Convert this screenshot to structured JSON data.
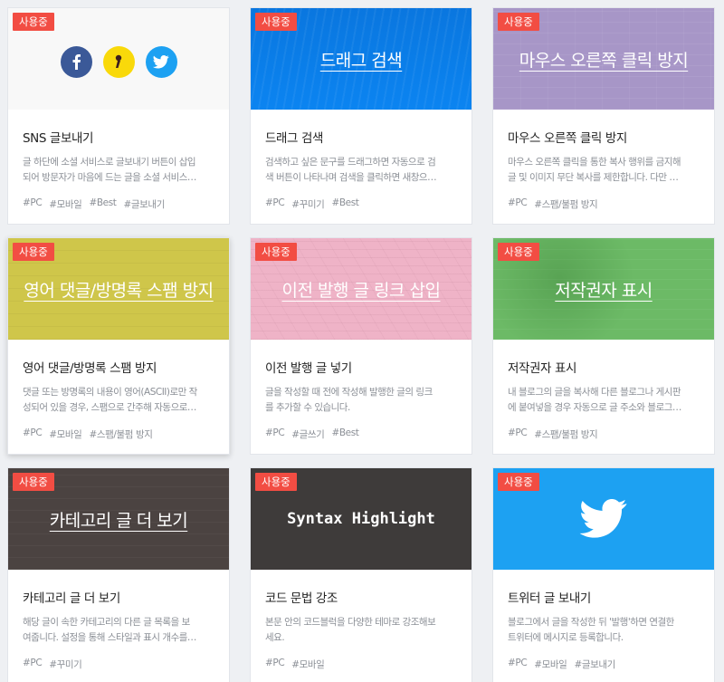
{
  "badge_label": "사용중",
  "cards": [
    {
      "thumb_title": "",
      "name": "SNS 글보내기",
      "desc": [
        "글 하단에 소셜 서비스로 글보내기 버튼이 삽입",
        "되어 방문자가 마음에 드는 글을 소셜 서비스…"
      ],
      "tags": [
        "#PC",
        "#모바일",
        "#Best",
        "#글보내기"
      ],
      "thumb_bg": "#f8f8f8",
      "icons": [
        "facebook-icon",
        "kakaostory-icon",
        "twitter-icon"
      ],
      "icon_colors": [
        "#3b5998",
        "#f9d90a",
        "#1da1f2"
      ]
    },
    {
      "thumb_title": "드래그 검색",
      "name": "드래그 검색",
      "desc": [
        "검색하고 싶은 문구를 드래그하면 자동으로 검",
        "색 버튼이 나타나며 검색을 클릭하면 새창으…"
      ],
      "tags": [
        "#PC",
        "#꾸미기",
        "#Best"
      ],
      "thumb_bg": "#0b84f1"
    },
    {
      "thumb_title": "마우스 오른쪽 클릭 방지",
      "name": "마우스 오른쪽 클릭 방지",
      "desc": [
        "마우스 오른쪽 클릭을 통한 복사 행위를 금지해",
        "글 및 이미지 무단 복사를 제한합니다. 다만 …"
      ],
      "tags": [
        "#PC",
        "#스팸/불펌 방지"
      ],
      "thumb_bg": "#a796c7"
    },
    {
      "thumb_title": "영어 댓글/방명록 스팸 방지",
      "name": "영어 댓글/방명록 스팸 방지",
      "desc": [
        "댓글 또는 방명록의 내용이 영어(ASCII)로만 작",
        "성되어 있을 경우, 스팸으로 간주해 자동으로…"
      ],
      "tags": [
        "#PC",
        "#모바일",
        "#스팸/불펌 방지"
      ],
      "thumb_bg": "#cfc64a"
    },
    {
      "thumb_title": "이전 발행 글 링크 삽입",
      "name": "이전 발행 글 넣기",
      "desc": [
        "글을 작성할 때 전에 작성해 발행한 글의 링크",
        "를 추가할 수 있습니다."
      ],
      "tags": [
        "#PC",
        "#글쓰기",
        "#Best"
      ],
      "thumb_bg": "#efb3c7"
    },
    {
      "thumb_title": "저작권자 표시",
      "name": "저작권자 표시",
      "desc": [
        "내 블로그의 글을 복사해 다른 블로그나 게시판",
        "에 붙여넣을 경우 자동으로 글 주소와 블로그…"
      ],
      "tags": [
        "#PC",
        "#스팸/불펌 방지"
      ],
      "thumb_bg": "#6cba66"
    },
    {
      "thumb_title": "카테고리 글 더 보기",
      "name": "카테고리 글 더 보기",
      "desc": [
        "해당 글이 속한 카테고리의 다른 글 목록을 보",
        "여줍니다. 설정을 통해 스타일과 표시 개수를…"
      ],
      "tags": [
        "#PC",
        "#꾸미기"
      ],
      "thumb_bg": "#4b4341"
    },
    {
      "thumb_title": "Syntax Highlight",
      "name": "코드 문법 강조",
      "desc": [
        "본문 안의 코드블럭을 다양한 테마로 강조해보",
        "세요."
      ],
      "tags": [
        "#PC",
        "#모바일"
      ],
      "thumb_bg": "#3e3b3a"
    },
    {
      "thumb_title": "",
      "name": "트위터 글 보내기",
      "desc": [
        "블로그에서 글을 작성한 뒤 '발행'하면 연결한",
        "트위터에 메시지로 등록합니다."
      ],
      "tags": [
        "#PC",
        "#모바일",
        "#글보내기"
      ],
      "thumb_bg": "#1da1f2",
      "icons": [
        "twitter-bird-icon"
      ]
    }
  ]
}
